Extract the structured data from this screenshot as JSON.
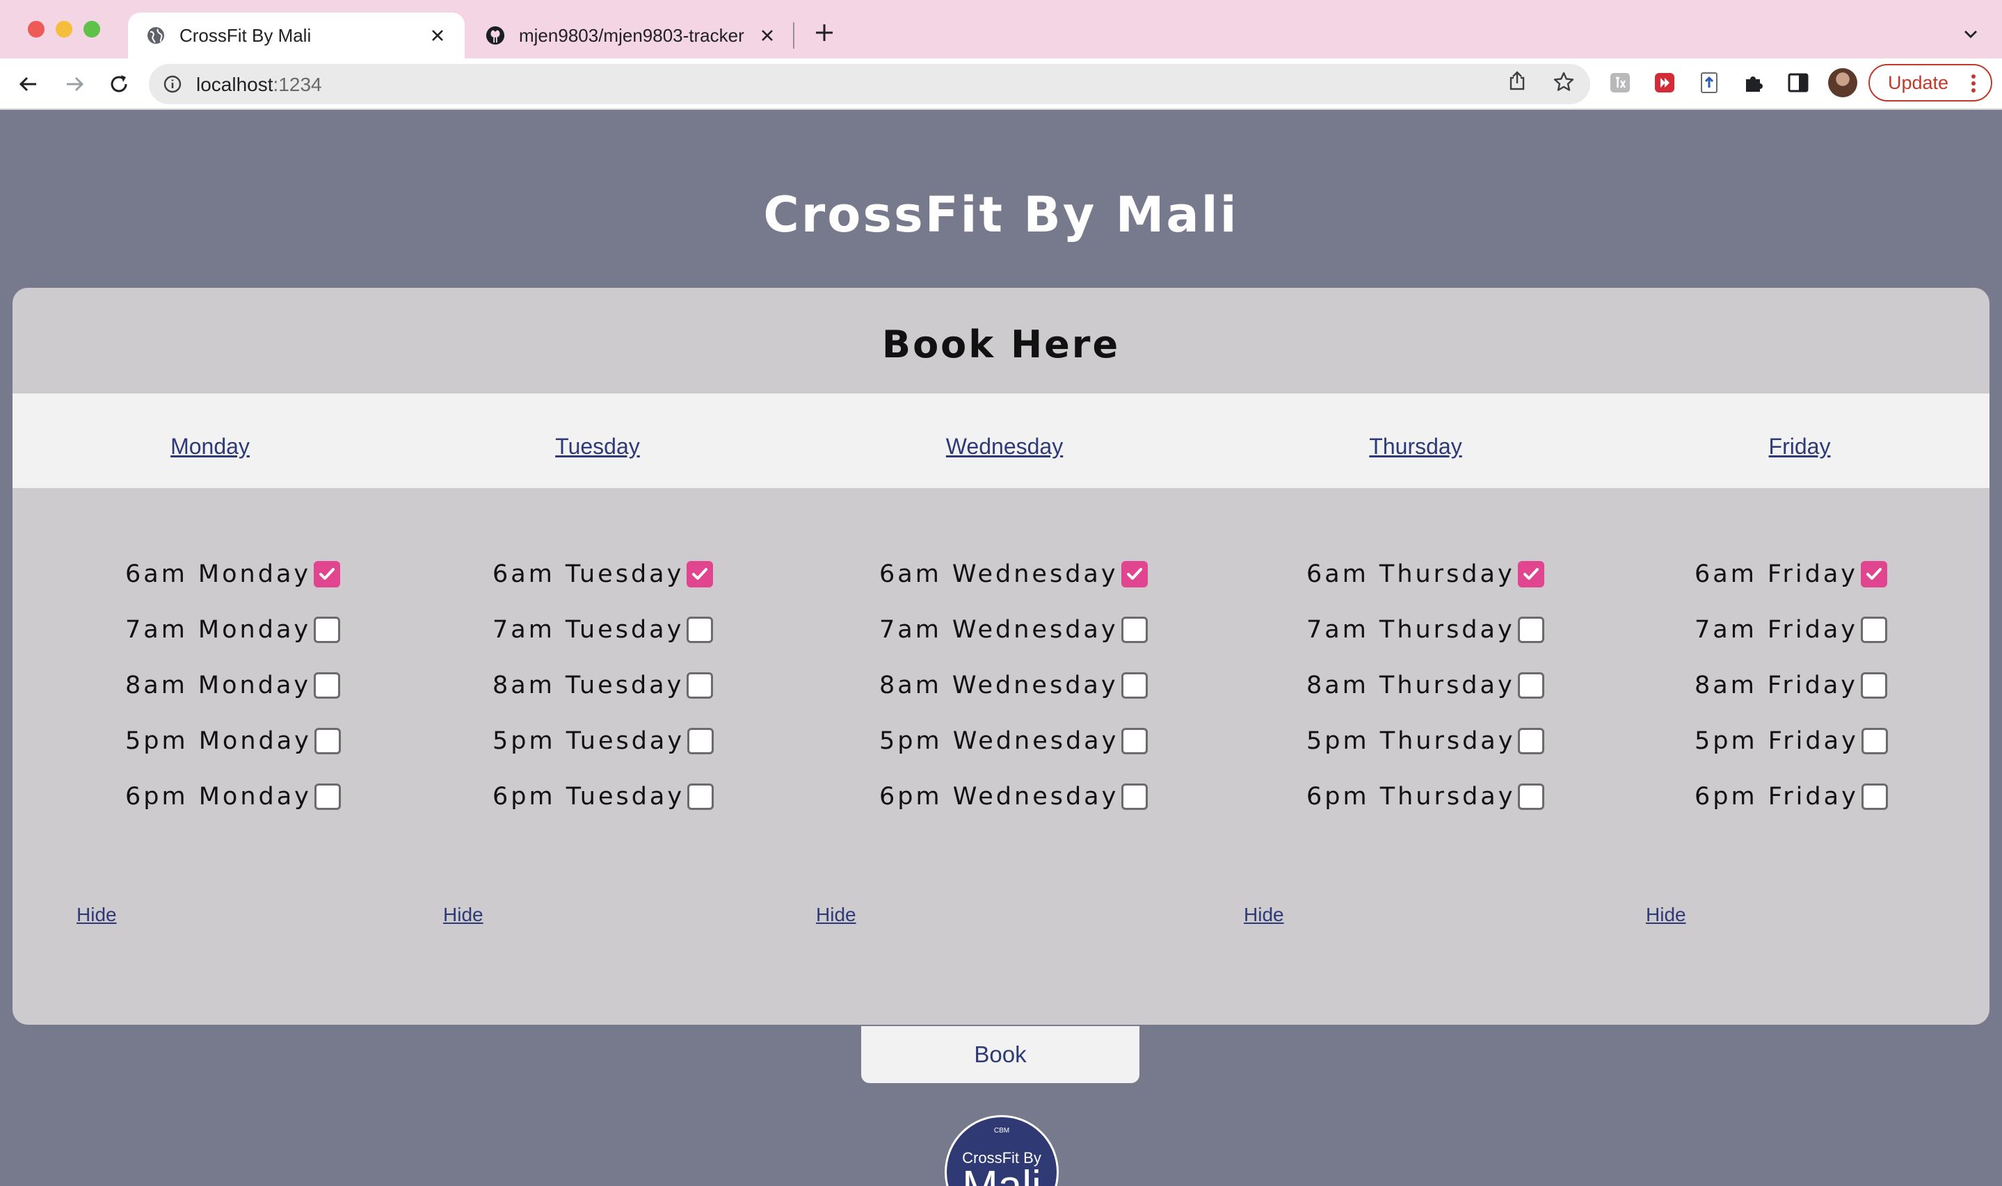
{
  "browser": {
    "tabs": [
      {
        "title": "CrossFit By Mali",
        "icon": "globe-icon"
      },
      {
        "title": "mjen9803/mjen9803-tracker",
        "icon": "github-icon"
      }
    ],
    "url_host": "localhost",
    "url_port": ":1234",
    "update_label": "Update"
  },
  "page": {
    "title": "CrossFit By Mali",
    "card_title": "Book Here",
    "days": [
      "Monday",
      "Tuesday",
      "Wednesday",
      "Thursday",
      "Friday"
    ],
    "times": [
      "6am",
      "7am",
      "8am",
      "5pm",
      "6pm"
    ],
    "slots": [
      [
        {
          "label": "6am Monday",
          "checked": true
        },
        {
          "label": "7am Monday",
          "checked": false
        },
        {
          "label": "8am Monday",
          "checked": false
        },
        {
          "label": "5pm Monday",
          "checked": false
        },
        {
          "label": "6pm Monday",
          "checked": false
        }
      ],
      [
        {
          "label": "6am Tuesday",
          "checked": true
        },
        {
          "label": "7am Tuesday",
          "checked": false
        },
        {
          "label": "8am Tuesday",
          "checked": false
        },
        {
          "label": "5pm Tuesday",
          "checked": false
        },
        {
          "label": "6pm Tuesday",
          "checked": false
        }
      ],
      [
        {
          "label": "6am Wednesday",
          "checked": true
        },
        {
          "label": "7am Wednesday",
          "checked": false
        },
        {
          "label": "8am Wednesday",
          "checked": false
        },
        {
          "label": "5pm Wednesday",
          "checked": false
        },
        {
          "label": "6pm Wednesday",
          "checked": false
        }
      ],
      [
        {
          "label": "6am Thursday",
          "checked": true
        },
        {
          "label": "7am Thursday",
          "checked": false
        },
        {
          "label": "8am Thursday",
          "checked": false
        },
        {
          "label": "5pm Thursday",
          "checked": false
        },
        {
          "label": "6pm Thursday",
          "checked": false
        }
      ],
      [
        {
          "label": "6am Friday",
          "checked": true
        },
        {
          "label": "7am Friday",
          "checked": false
        },
        {
          "label": "8am Friday",
          "checked": false
        },
        {
          "label": "5pm Friday",
          "checked": false
        },
        {
          "label": "6pm Friday",
          "checked": false
        }
      ]
    ],
    "hide_label": "Hide",
    "book_label": "Book",
    "logo": {
      "small": "CBM",
      "line1": "CrossFit By",
      "line2": "Mali"
    }
  },
  "colors": {
    "page_bg": "#777a8c",
    "card_bg": "#cdcbcd",
    "nav_bg": "#f2f2f2",
    "link": "#2e3a78",
    "checkbox_checked": "#e2458f",
    "tabbar_bg": "#f3d5e4"
  }
}
